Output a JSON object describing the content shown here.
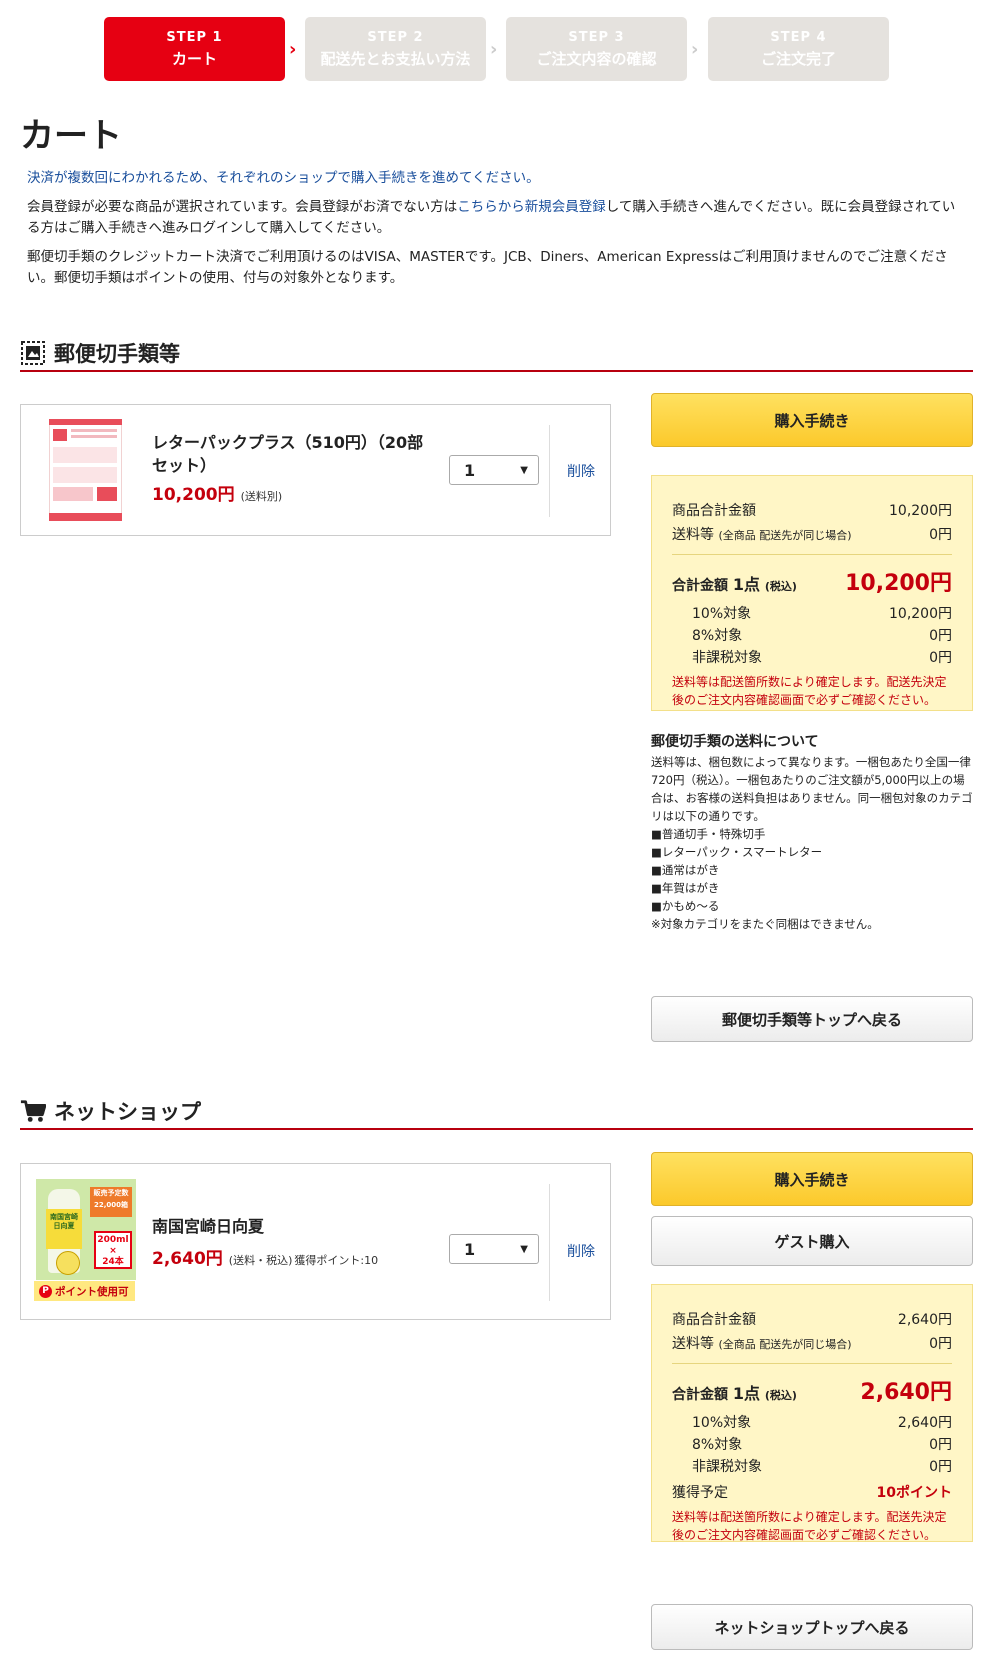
{
  "steps": [
    {
      "num": "STEP 1",
      "label": "カート"
    },
    {
      "num": "STEP 2",
      "label": "配送先とお支払い方法"
    },
    {
      "num": "STEP 3",
      "label": "ご注文内容の確認"
    },
    {
      "num": "STEP 4",
      "label": "ご注文完了"
    }
  ],
  "page_title": "カート",
  "intro": {
    "notice": "決済が複数回にわかれるため、それぞれのショップで購入手続きを進めてください。",
    "member_pre": "会員登録が必要な商品が選択されています。会員登録がお済でない方は",
    "member_link": "こちらから新規会員登録",
    "member_post": "して購入手続きへ進んでください。既に会員登録されている方はご購入手続きへ進みログインして購入してください。",
    "credit": "郵便切手類のクレジットカート決済でご利用頂けるのはVISA、MASTERです。JCB、Diners、American Expressはご利用頂けませんのでご注意ください。郵便切手類はポイントの使用、付与の対象外となります。"
  },
  "shop1": {
    "title": "郵便切手類等",
    "item": {
      "name": "レターパックプラス（510円）（20部セット）",
      "price": "10,200円",
      "price_note": "(送料別)",
      "qty": "1",
      "delete": "削除"
    },
    "buy_button": "購入手続き",
    "summary": {
      "subtotal_label": "商品合計金額",
      "subtotal": "10,200円",
      "shipping_label": "送料等",
      "shipping_note": "(全商品 配送先が同じ場合)",
      "shipping": "0円",
      "total_label": "合計金額",
      "total_count": "1点",
      "total_tax": "(税込)",
      "total": "10,200円",
      "r10_label": "10%対象",
      "r10": "10,200円",
      "r8_label": "8%対象",
      "r8": "0円",
      "nontax_label": "非課税対象",
      "nontax": "0円",
      "note": "送料等は配送箇所数により確定します。配送先決定後のご注文内容確認画面で必ずご確認ください。"
    },
    "shipping_info": {
      "heading": "郵便切手類の送料について",
      "body": "送料等は、梱包数によって異なります。一梱包あたり全国一律720円（税込）。一梱包あたりのご注文額が5,000円以上の場合は、お客様の送料負担はありません。同一梱包対象のカテゴリは以下の通りです。",
      "items": [
        "■普通切手・特殊切手",
        "■レターパック・スマートレター",
        "■通常はがき",
        "■年賀はがき",
        "■かもめ～る"
      ],
      "footer": "※対象カテゴリをまたぐ同梱はできません。"
    },
    "back_button": "郵便切手類等トップへ戻る"
  },
  "shop2": {
    "title": "ネットショップ",
    "item": {
      "name": "南国宮崎日向夏",
      "price": "2,640円",
      "price_note": "(送料・税込)",
      "points_note": "獲得ポイント:10",
      "qty": "1",
      "delete": "削除",
      "badge": "ポイント使用可",
      "thumb_badge_top": "販売予定数",
      "thumb_badge_num": "22,000箱",
      "thumb_label": "南国宮崎 日向夏",
      "thumb_size1": "200ml",
      "thumb_size2": "×",
      "thumb_size3": "24本"
    },
    "buy_button": "購入手続き",
    "guest_button": "ゲスト購入",
    "summary": {
      "subtotal_label": "商品合計金額",
      "subtotal": "2,640円",
      "shipping_label": "送料等",
      "shipping_note": "(全商品 配送先が同じ場合)",
      "shipping": "0円",
      "total_label": "合計金額",
      "total_count": "1点",
      "total_tax": "(税込)",
      "total": "2,640円",
      "r10_label": "10%対象",
      "r10": "2,640円",
      "r8_label": "8%対象",
      "r8": "0円",
      "nontax_label": "非課税対象",
      "nontax": "0円",
      "points_label": "獲得予定",
      "points": "10ポイント",
      "note": "送料等は配送箇所数により確定します。配送先決定後のご注文内容確認画面で必ずご確認ください。"
    },
    "back_button": "ネットショップトップへ戻る"
  },
  "colors": {
    "accent": "#e60012",
    "price": "#c4000d",
    "link": "#1a4f9c",
    "buy": "#fbc92b",
    "summary_bg": "#fff6c6"
  }
}
